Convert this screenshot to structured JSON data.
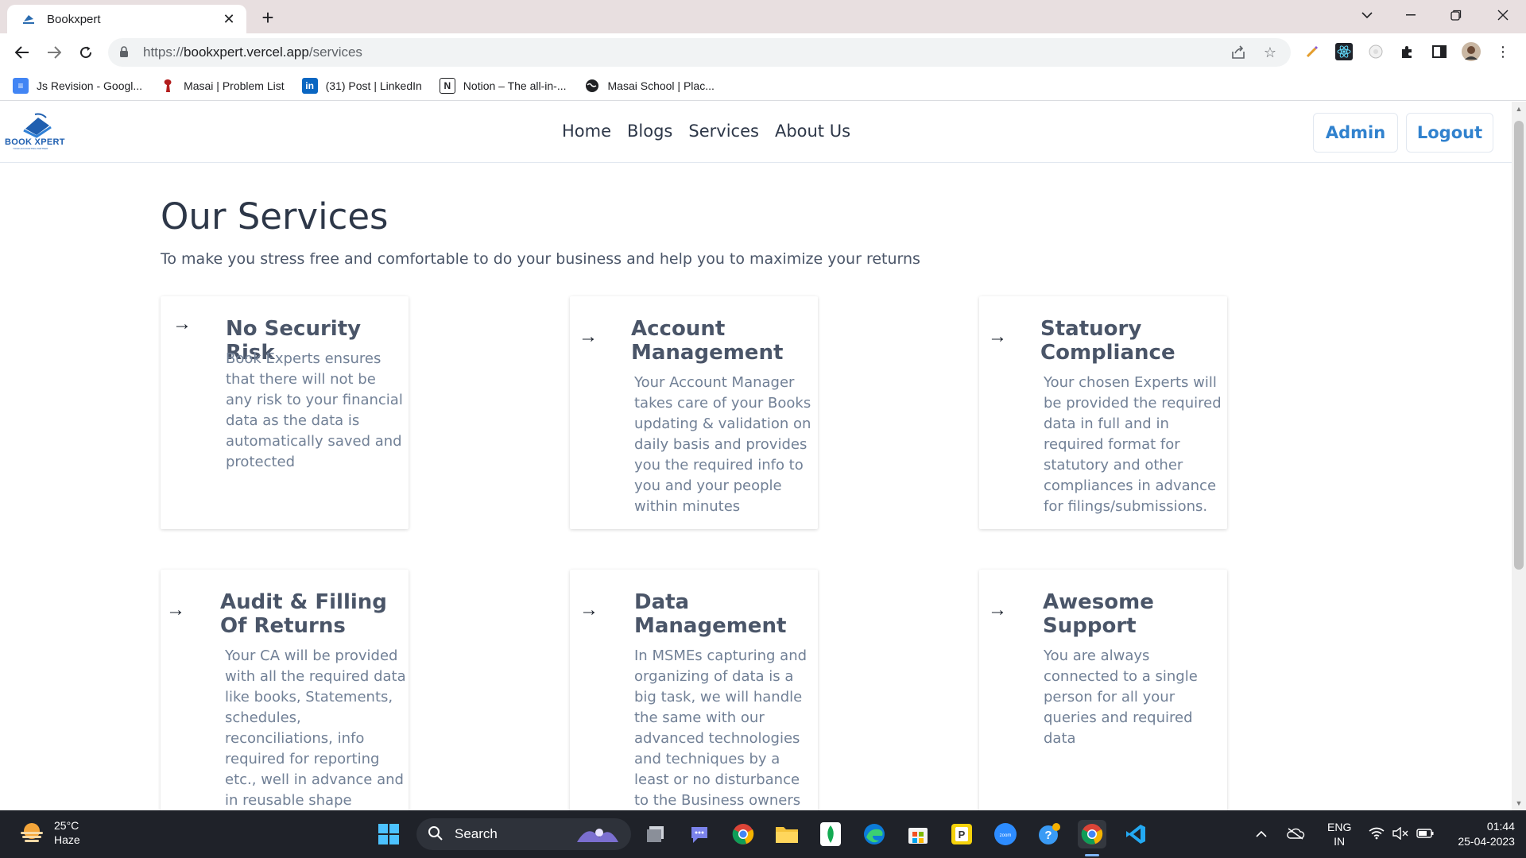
{
  "browser": {
    "tab_title": "Bookxpert",
    "url_prefix": "https://",
    "url_host": "bookxpert.vercel.app",
    "url_path": "/services",
    "bookmarks": [
      {
        "label": "Js Revision - Googl...",
        "icon": "docs-icon"
      },
      {
        "label": "Masai | Problem List",
        "icon": "masai-icon"
      },
      {
        "label": "(31) Post | LinkedIn",
        "icon": "linkedin-icon"
      },
      {
        "label": "Notion – The all-in-...",
        "icon": "notion-icon"
      },
      {
        "label": "Masai School | Plac...",
        "icon": "globe-icon"
      }
    ]
  },
  "site": {
    "logo_text": "BOOK XPERT",
    "logo_tagline": "YOUR ACCOUNTING PARTNER",
    "nav": [
      "Home",
      "Blogs",
      "Services",
      "About Us"
    ],
    "admin_label": "Admin",
    "logout_label": "Logout",
    "brand_color": "#3182ce"
  },
  "services_page": {
    "title": "Our Services",
    "subtitle": "To make you stress free and comfortable to do your business and help you to maximize your returns",
    "cards": [
      {
        "title": "No Security Risk",
        "desc": "Book Experts ensures that there will not be any risk to your financial data as the data is automatically saved and protected"
      },
      {
        "title": "Account Management",
        "desc": "Your Account Manager takes care of your Books updating & validation on daily basis and provides you the required info to you and your people within minutes"
      },
      {
        "title": "Statuory Compliance",
        "desc": "Your chosen Experts will be provided the required data in full and in required format for statutory and other compliances in advance for filings/submissions."
      },
      {
        "title": "Audit & Filling Of Returns",
        "desc": "Your CA will be provided with all the required data like books, Statements, schedules, reconciliations, info required for reporting etc., well in advance and in reusable shape"
      },
      {
        "title": "Data Management",
        "desc": "In MSMEs capturing and organizing of data is a big task, we will handle the same with our advanced technologies and techniques by a least or no disturbance to the Business owners"
      },
      {
        "title": "Awesome Support",
        "desc": "You are always connected to a single person for all your queries and required data"
      }
    ]
  },
  "taskbar": {
    "temperature": "25°C",
    "weather": "Haze",
    "search_placeholder": "Search",
    "lang_top": "ENG",
    "lang_bottom": "IN",
    "time": "01:44",
    "date": "25-04-2023"
  }
}
